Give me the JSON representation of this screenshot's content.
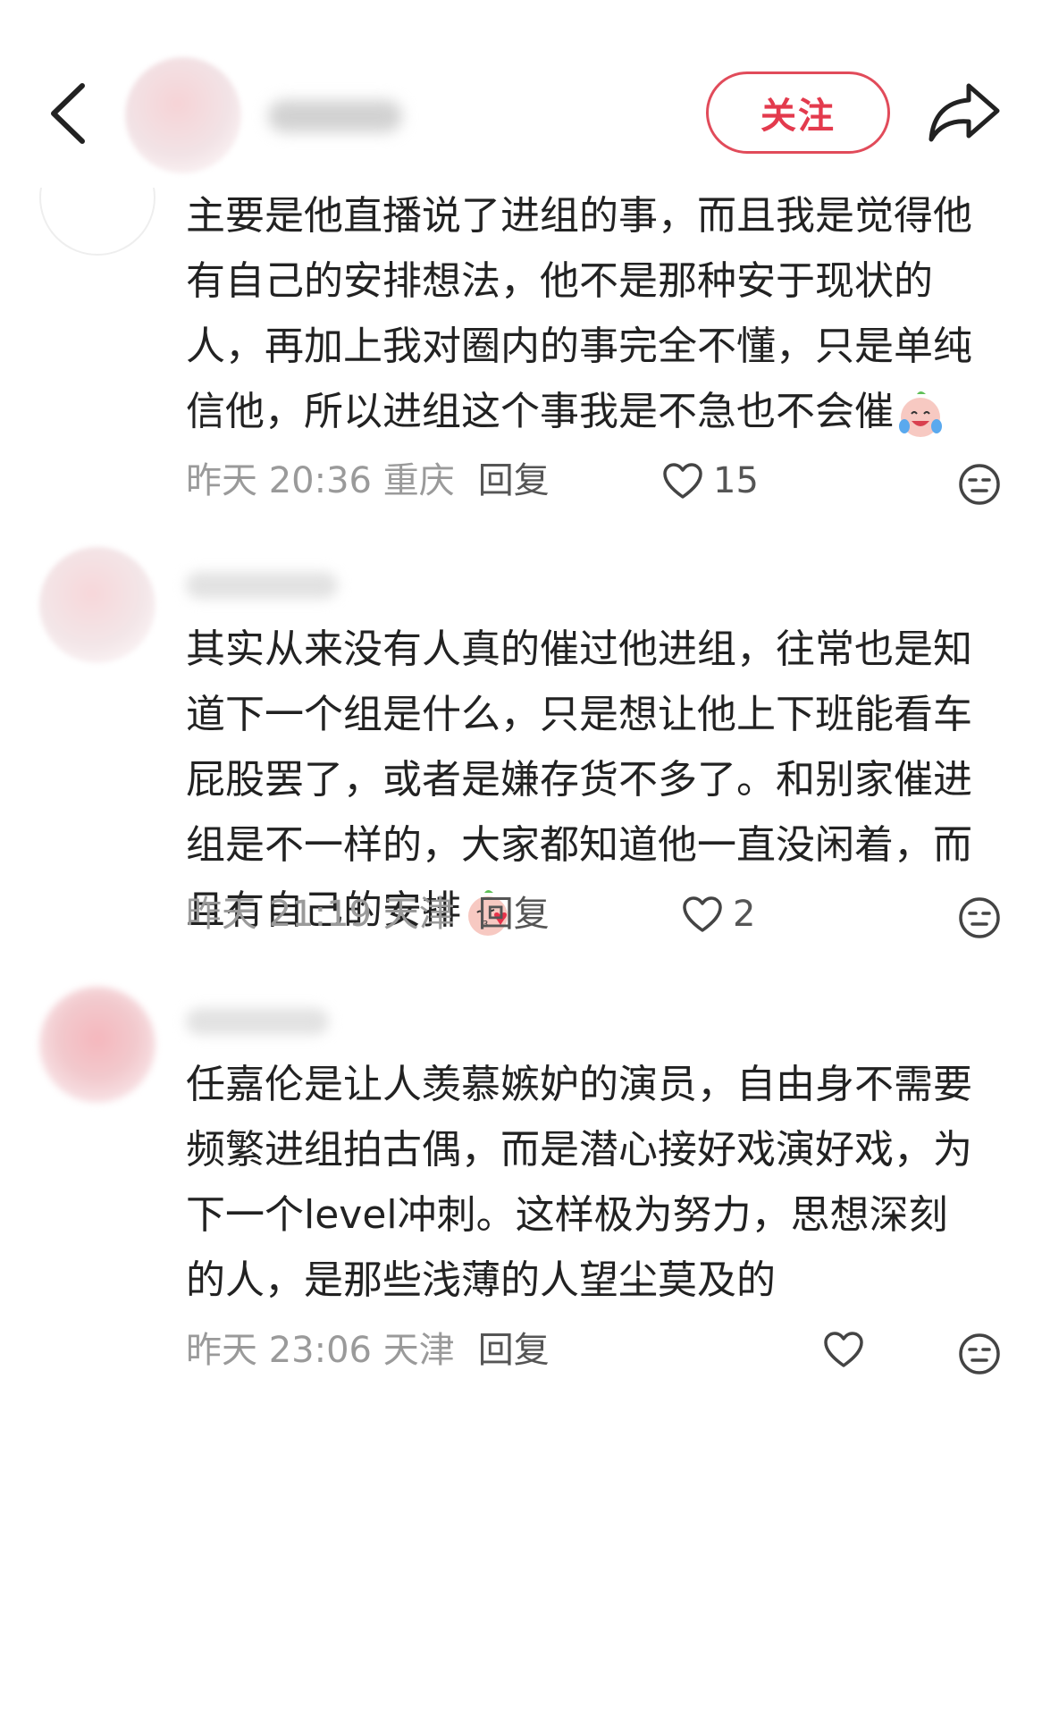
{
  "header": {
    "follow_label": "关注"
  },
  "comments": [
    {
      "text": "主要是他直播说了进组的事，而且我是觉得他有自己的安排想法，他不是那种安于现状的人，再加上我对圈内的事完全不懂，只是单纯信他，所以进组这个事我是不急也不会催",
      "emoji": "crying-laughing-face-icon",
      "time": "昨天 20:36 重庆",
      "reply_label": "回复",
      "likes": "15"
    },
    {
      "text": "其实从来没有人真的催过他进组，往常也是知道下一个组是什么，只是想让他上下班能看车屁股罢了，或者是嫌存货不多了。和别家催进组是不一样的，大家都知道他一直没闲着，而且有自己的安排",
      "emoji": "kissing-heart-face-icon",
      "time": "昨天 21:19 天津",
      "reply_label": "回复",
      "likes": "2"
    },
    {
      "text": "任嘉伦是让人羡慕嫉妒的演员，自由身不需要频繁进组拍古偶，而是潜心接好戏演好戏，为下一个level冲刺。这样极为努力，思想深刻的人，是那些浅薄的人望尘莫及的",
      "time": "昨天 23:06 天津",
      "reply_label": "回复",
      "likes": ""
    }
  ],
  "colors": {
    "accent": "#e33a4d",
    "text": "#222222",
    "meta": "#9a9a9a"
  }
}
